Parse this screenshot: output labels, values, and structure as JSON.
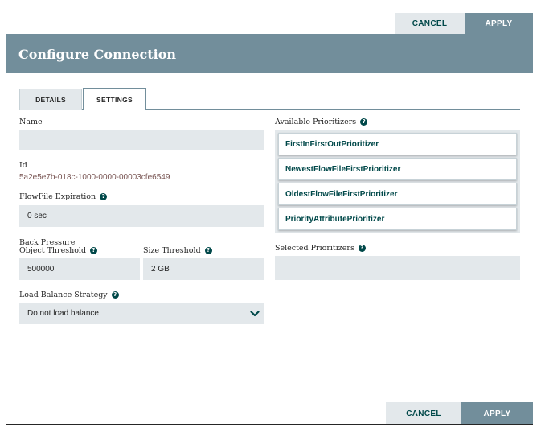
{
  "top_actions": {
    "cancel": "CANCEL",
    "apply": "APPLY"
  },
  "dialog": {
    "title": "Configure Connection"
  },
  "tabs": [
    {
      "label": "DETAILS",
      "active": false
    },
    {
      "label": "SETTINGS",
      "active": true
    }
  ],
  "settings": {
    "name": {
      "label": "Name",
      "value": ""
    },
    "id": {
      "label": "Id",
      "value": "5a2e5e7b-018c-1000-0000-00003cfe6549"
    },
    "flowfile_expiration": {
      "label": "FlowFile Expiration",
      "value": "0 sec"
    },
    "back_pressure": {
      "label": "Back Pressure",
      "object_threshold": {
        "label": "Object Threshold",
        "value": "500000"
      },
      "size_threshold": {
        "label": "Size Threshold",
        "value": "2 GB"
      }
    },
    "load_balance": {
      "label": "Load Balance Strategy",
      "value": "Do not load balance"
    }
  },
  "prioritizers": {
    "available_label": "Available Prioritizers",
    "available": [
      "FirstInFirstOutPrioritizer",
      "NewestFlowFileFirstPrioritizer",
      "OldestFlowFileFirstPrioritizer",
      "PriorityAttributePrioritizer"
    ],
    "selected_label": "Selected Prioritizers"
  },
  "bottom_actions": {
    "cancel": "CANCEL",
    "apply": "APPLY"
  },
  "colors": {
    "header": "#728e9b",
    "field": "#e3e8eb",
    "accent": "#004849",
    "id_text": "#775351"
  },
  "icons": {
    "help": "question-circle-icon",
    "dropdown": "chevron-down-icon"
  }
}
